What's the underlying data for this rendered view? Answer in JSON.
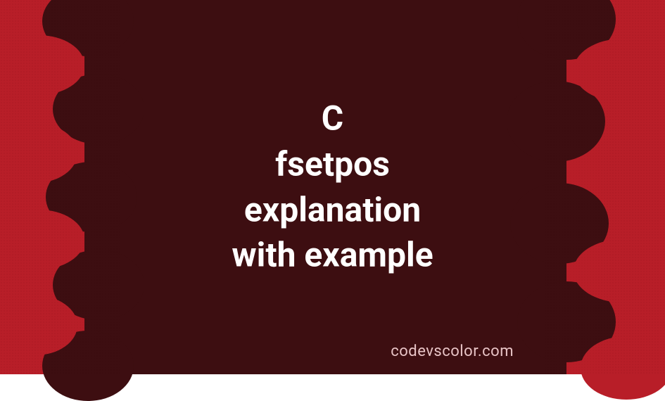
{
  "title": {
    "line1": "C",
    "line2": "fsetpos",
    "line3": "explanation",
    "line4": "with example"
  },
  "watermark": "codevscolor.com",
  "colors": {
    "background_red": "#b81e28",
    "dark_maroon": "#3d0e11",
    "text": "#ffffff"
  }
}
